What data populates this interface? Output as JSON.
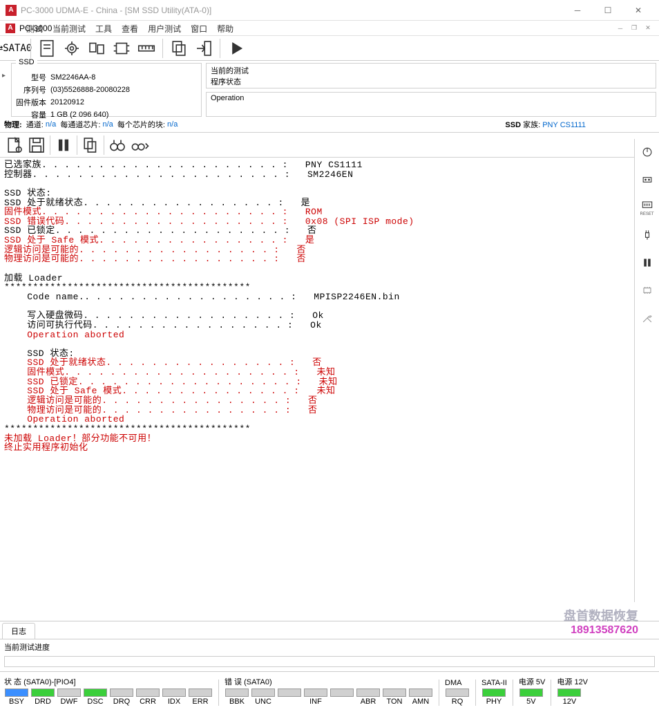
{
  "title": "PC-3000 UDMA-E - China - [SM SSD Utility(ATA-0)]",
  "subtitle": "PC-3000",
  "menu": [
    "测试",
    "当前测试",
    "工具",
    "查看",
    "用户测试",
    "窗口",
    "帮助"
  ],
  "sata_label": "SATA0",
  "ssd_box": {
    "title": "SSD",
    "rows": [
      {
        "k": "型号",
        "v": "SM2246AA-8"
      },
      {
        "k": "序列号",
        "v": "(03)5526888-20080228"
      },
      {
        "k": "固件版本",
        "v": "20120912"
      },
      {
        "k": "容量",
        "v": "1 GB (2 096 640)"
      }
    ]
  },
  "current_test": {
    "title": "当前的测试",
    "sub": "程序状态"
  },
  "operation_title": "Operation",
  "phys": {
    "label": "物理:",
    "ch": "通道:",
    "ch_v": "n/a",
    "perch": "每通道芯片:",
    "perch_v": "n/a",
    "blk": "每个芯片的块:",
    "blk_v": "n/a",
    "ssd": "SSD",
    "fam": "家族:",
    "fam_v": "PNY CS1111"
  },
  "log": {
    "l1": "已选家族. . . . . . . . . . . . . . . . . . . . . :   PNY CS1111",
    "l2": "控制器. . . . . . . . . . . . . . . . . . . . . . :   SM2246EN",
    "blank": "",
    "l3": "SSD 状态:",
    "l4": "SSD 处于就绪状态. . . . . . . . . . . . . . . . . :   是",
    "l5": "固件模式. . . . . . . . . . . . . . . . . . . . . :   ROM",
    "l6": "SSD 错误代码. . . . . . . . . . . . . . . . . . . :   0x08 (SPI ISP mode)",
    "l7": "SSD 已锁定. . . . . . . . . . . . . . . . . . . . :   否",
    "l8": "SSD 处于 Safe 模式. . . . . . . . . . . . . . . . :   是",
    "l9": "逻辑访问是可能的. . . . . . . . . . . . . . . . . :   否",
    "l10": "物理访问是可能的. . . . . . . . . . . . . . . . . :   否",
    "l11": "加载 Loader",
    "l12": "*******************************************",
    "l13": "    Code name.. . . . . . . . . . . . . . . . . . :   MPISP2246EN.bin",
    "l14": "    写入硬盘微码. . . . . . . . . . . . . . . . . . :   Ok",
    "l15": "    访问可执行代码. . . . . . . . . . . . . . . . . :   Ok",
    "l16": "    Operation aborted",
    "l17": "    SSD 状态:",
    "l18": "    SSD 处于就绪状态. . . . . . . . . . . . . . . . :   否",
    "l19": "    固件模式. . . . . . . . . . . . . . . . . . . . :   未知",
    "l20": "    SSD 已锁定. . . . . . . . . . . . . . . . . . . :   未知",
    "l21": "    SSD 处于 Safe 模式. . . . . . . . . . . . . . . :   未知",
    "l22": "    逻辑访问是可能的. . . . . . . . . . . . . . . . :   否",
    "l23": "    物理访问是可能的. . . . . . . . . . . . . . . . :   否",
    "l24": "    Operation aborted",
    "l25": "*******************************************",
    "l26": "未加载 Loader！部分功能不可用！",
    "l27": "终止实用程序初始化"
  },
  "watermark": {
    "name": "盘首数据恢复",
    "phone": "18913587620"
  },
  "tab_label": "日志",
  "progress_label": "当前测试进度",
  "status": {
    "g1": {
      "title": "状 态 (SATA0)-[PIO4]",
      "cells": [
        {
          "t": "BSY",
          "c": "blue"
        },
        {
          "t": "DRD",
          "c": "green"
        },
        {
          "t": "DWF",
          "c": ""
        },
        {
          "t": "DSC",
          "c": "green"
        },
        {
          "t": "DRQ",
          "c": ""
        },
        {
          "t": "CRR",
          "c": ""
        },
        {
          "t": "IDX",
          "c": ""
        },
        {
          "t": "ERR",
          "c": ""
        }
      ]
    },
    "g2": {
      "title": "错 误 (SATA0)",
      "cells": [
        {
          "t": "BBK",
          "c": ""
        },
        {
          "t": "UNC",
          "c": ""
        },
        {
          "t": "",
          "c": ""
        },
        {
          "t": "INF",
          "c": ""
        },
        {
          "t": "",
          "c": ""
        },
        {
          "t": "ABR",
          "c": ""
        },
        {
          "t": "TON",
          "c": ""
        },
        {
          "t": "AMN",
          "c": ""
        }
      ]
    },
    "g3": {
      "title": "DMA",
      "cells": [
        {
          "t": "RQ",
          "c": ""
        }
      ]
    },
    "g4": {
      "title": "SATA-II",
      "cells": [
        {
          "t": "PHY",
          "c": "green"
        }
      ]
    },
    "g5": {
      "title": "电源 5V",
      "cells": [
        {
          "t": "5V",
          "c": "green"
        }
      ]
    },
    "g6": {
      "title": "电源 12V",
      "cells": [
        {
          "t": "12V",
          "c": "green"
        }
      ]
    }
  },
  "side_reset": "RESET"
}
